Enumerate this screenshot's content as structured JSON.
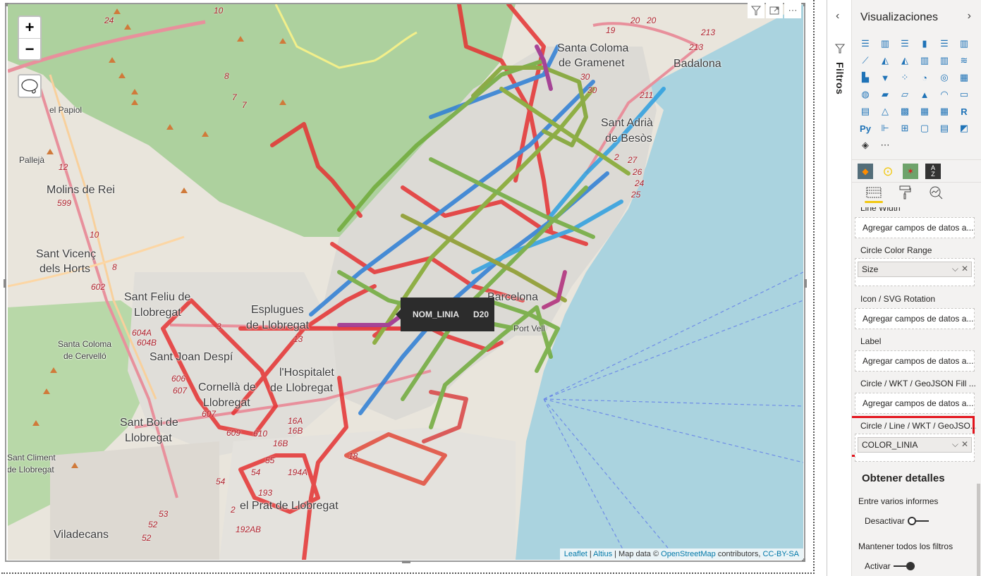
{
  "map": {
    "zoom_in_label": "+",
    "zoom_out_label": "−",
    "tooltip": {
      "field": "NOM_LINIA",
      "value": "D20"
    },
    "attribution": {
      "leaflet": "Leaflet",
      "sep1": " | ",
      "altius": "Altius",
      "middle": " | Map data © ",
      "osm": "OpenStreetMap",
      "contrib": " contributors, ",
      "license": "CC-BY-SA"
    },
    "place_labels": [
      {
        "text": "Santa Coloma",
        "cls": ""
      },
      {
        "text": "de Gramenet",
        "cls": ""
      },
      {
        "text": "Badalona",
        "cls": ""
      },
      {
        "text": "Sant Adrià",
        "cls": ""
      },
      {
        "text": "de Besòs",
        "cls": ""
      },
      {
        "text": "el Papiol",
        "cls": "small"
      },
      {
        "text": "Pallejà",
        "cls": "small"
      },
      {
        "text": "Molins de Rei",
        "cls": ""
      },
      {
        "text": "Sant Vicenç",
        "cls": ""
      },
      {
        "text": "dels Horts",
        "cls": ""
      },
      {
        "text": "Sant Feliu de",
        "cls": ""
      },
      {
        "text": "Llobregat",
        "cls": ""
      },
      {
        "text": "Esplugues",
        "cls": ""
      },
      {
        "text": "de Llobregat",
        "cls": ""
      },
      {
        "text": "Barcelona",
        "cls": ""
      },
      {
        "text": "Port Vell",
        "cls": "small"
      },
      {
        "text": "Santa Coloma",
        "cls": "small"
      },
      {
        "text": "de Cervelló",
        "cls": "small"
      },
      {
        "text": "Sant Joan Despí",
        "cls": ""
      },
      {
        "text": "l'Hospitalet",
        "cls": ""
      },
      {
        "text": "de Llobregat",
        "cls": ""
      },
      {
        "text": "Cornellà de",
        "cls": ""
      },
      {
        "text": "Llobregat",
        "cls": ""
      },
      {
        "text": "Sant Boi de",
        "cls": ""
      },
      {
        "text": "Llobregat",
        "cls": ""
      },
      {
        "text": "Sant Climent",
        "cls": "small"
      },
      {
        "text": "de Llobregat",
        "cls": "small"
      },
      {
        "text": "el Prat de Llobregat",
        "cls": ""
      },
      {
        "text": "Viladecans",
        "cls": ""
      }
    ],
    "road_numbers": [
      "24",
      "20",
      "20",
      "19",
      "213",
      "213",
      "211",
      "30",
      "30",
      "2",
      "27",
      "26",
      "24",
      "25",
      "12",
      "599",
      "10",
      "8",
      "602",
      "604A",
      "604B",
      "3",
      "13",
      "606",
      "607",
      "607",
      "609",
      "610",
      "16A",
      "16B",
      "16B",
      "55",
      "54",
      "54",
      "18",
      "194A",
      "193",
      "2",
      "192AB",
      "53",
      "52",
      "52",
      "8",
      "7",
      "7",
      "10"
    ]
  },
  "visual_header": {
    "filter_icon": "funnel-icon",
    "focus_icon": "focus-mode-icon",
    "more_icon": "more-options-icon"
  },
  "filters_pane": {
    "label": "Filtros",
    "collapse_icon": "chevron-left-icon"
  },
  "viz_pane": {
    "title": "Visualizaciones",
    "expand_icon": "chevron-right-icon",
    "visual_types": [
      "stacked-bar-chart",
      "stacked-column-chart",
      "clustered-bar-chart",
      "clustered-column-chart",
      "100-stacked-bar-chart",
      "100-stacked-column-chart",
      "line-chart",
      "area-chart",
      "stacked-area-chart",
      "line-and-stacked-column-chart",
      "line-and-clustered-column-chart",
      "ribbon-chart",
      "waterfall-chart",
      "funnel-chart",
      "scatter-chart",
      "pie-chart",
      "donut-chart",
      "treemap",
      "map",
      "filled-map",
      "shape-map",
      "azure-map",
      "gauge",
      "card",
      "multi-row-card",
      "kpi",
      "slicer",
      "table",
      "matrix",
      "r-script-visual",
      "python-visual",
      "key-influencers",
      "decomposition-tree",
      "qa-visual",
      "smart-narrative",
      "arcgis-map",
      "power-apps",
      "more-visuals"
    ],
    "custom_visuals": [
      "icon-map-visual",
      "play-axis-visual",
      "route-map-visual",
      "sort-visual"
    ],
    "tabs": [
      "fields-tab",
      "format-tab",
      "analytics-tab"
    ],
    "fields": [
      {
        "label": "Line Width",
        "value": "",
        "placeholder": "Agregar campos de datos a..."
      },
      {
        "label": "Circle Color Range",
        "value": "Size",
        "placeholder": ""
      },
      {
        "label": "Icon / SVG Rotation",
        "value": "",
        "placeholder": "Agregar campos de datos a..."
      },
      {
        "label": "Label",
        "value": "",
        "placeholder": "Agregar campos de datos a..."
      },
      {
        "label": "Circle / WKT / GeoJSON Fill ...",
        "value": "",
        "placeholder": "Agregar campos de datos a..."
      },
      {
        "label": "Circle / Line / WKT / GeoJSO...",
        "value": "COLOR_LINIA",
        "placeholder": ""
      }
    ],
    "drillthrough": {
      "title": "Obtener detalles",
      "cross_report_label": "Entre varios informes",
      "cross_report_state": "Desactivar",
      "keep_filters_label": "Mantener todos los filtros",
      "keep_filters_state": "Activar"
    },
    "highlight_color": "#e3141d"
  }
}
